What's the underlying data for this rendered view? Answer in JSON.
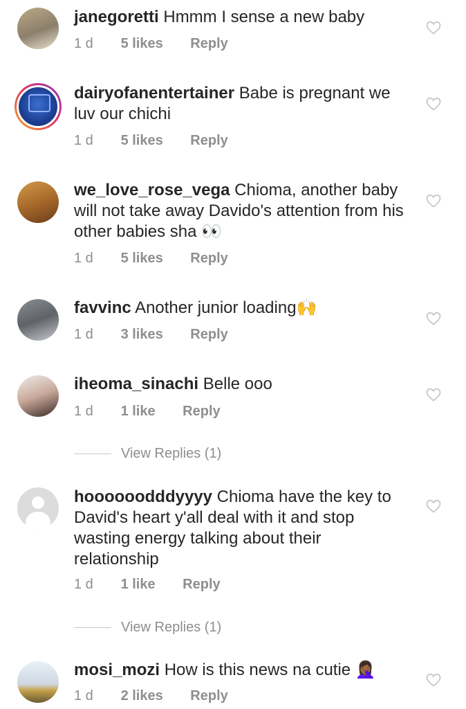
{
  "comments": [
    {
      "username": "janegoretti",
      "text": "Hmmm I sense a new baby",
      "time": "1 d",
      "likes": "5 likes",
      "reply": "Reply"
    },
    {
      "username": "dairyofanentertainer",
      "text": "Babe is pregnant we luv our chichi",
      "time": "1 d",
      "likes": "5 likes",
      "reply": "Reply"
    },
    {
      "username": "we_love_rose_vega",
      "text": "Chioma, another baby will not take away Davido's attention from his other babies sha 👀",
      "time": "1 d",
      "likes": "5 likes",
      "reply": "Reply"
    },
    {
      "username": "favvinc",
      "text": "Another junior loading🙌",
      "time": "1 d",
      "likes": "3 likes",
      "reply": "Reply"
    },
    {
      "username": "iheoma_sinachi",
      "text": "Belle ooo",
      "time": "1 d",
      "likes": "1 like",
      "reply": "Reply",
      "view_replies": "View Replies (1)"
    },
    {
      "username": "hoooooodddyyyy",
      "text": "Chioma have the key to David's heart y'all deal with it and stop wasting energy talking about their relationship",
      "time": "1 d",
      "likes": "1 like",
      "reply": "Reply",
      "view_replies": "View Replies (1)"
    },
    {
      "username": "mosi_mozi",
      "text": "How is this news na cutie 🤦🏾‍♀️",
      "time": "1 d",
      "likes": "2 likes",
      "reply": "Reply"
    }
  ],
  "icons": {
    "like": "heart-outline-icon"
  },
  "colors": {
    "text": "#262626",
    "meta": "#8e8e8e",
    "heart": "#c7c7c7"
  }
}
